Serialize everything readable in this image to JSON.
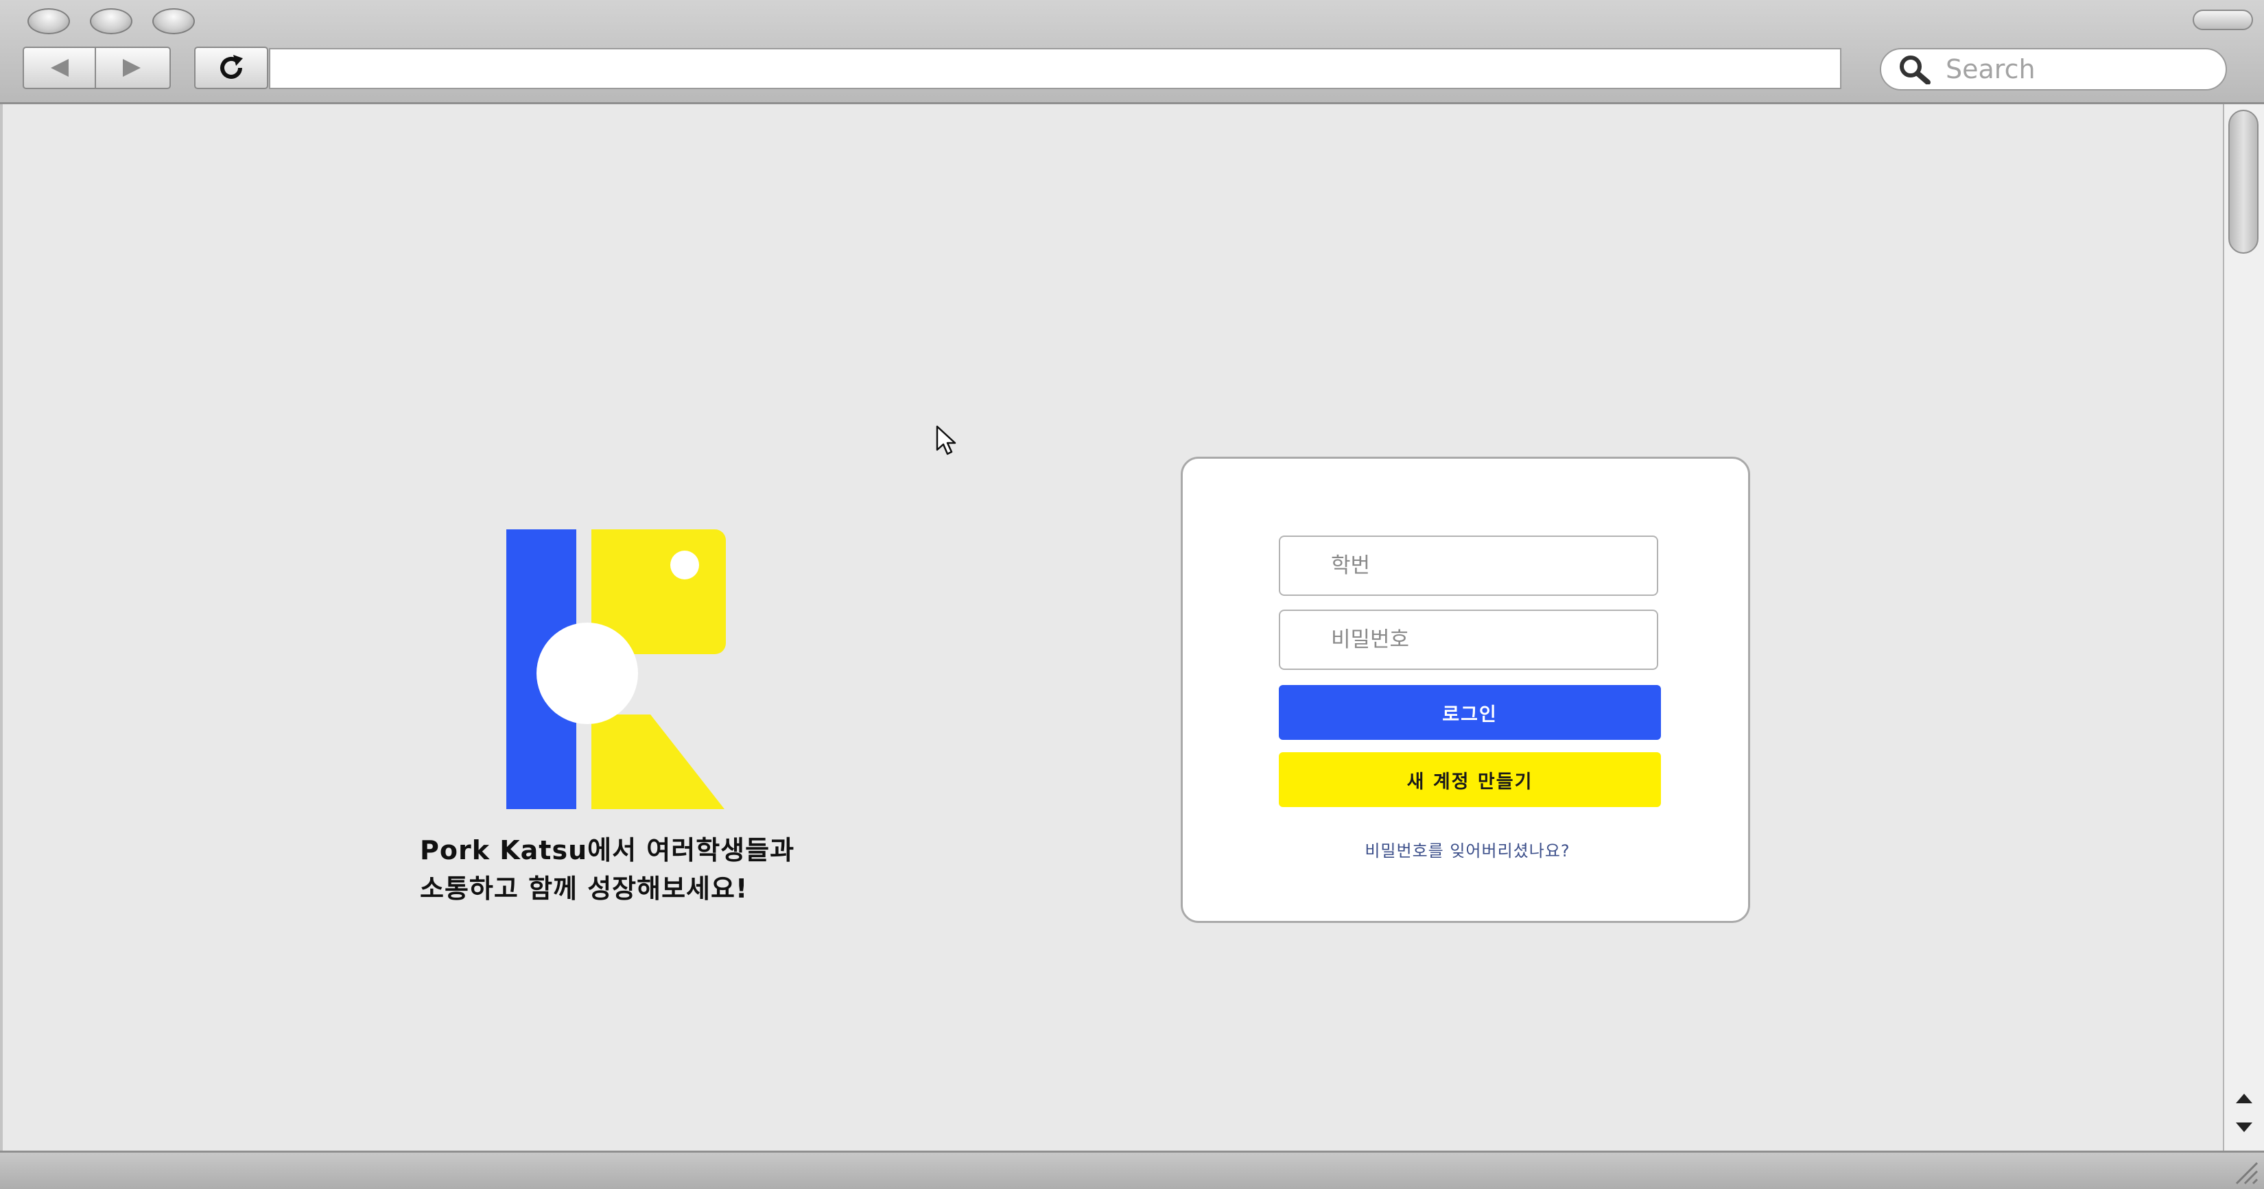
{
  "browser": {
    "url": "",
    "search_placeholder": "Search",
    "icons": {
      "back": "back-arrow-icon",
      "forward": "forward-arrow-icon",
      "reload": "reload-icon",
      "search": "search-icon"
    }
  },
  "brand": {
    "logo_colors": {
      "blue": "#2c58f5",
      "yellow": "#faed16",
      "white": "#ffffff"
    },
    "tagline_line1": "Pork Katsu에서 여러학생들과",
    "tagline_line2": "소통하고 함께 성장해보세요!"
  },
  "login": {
    "student_id_placeholder": "학번",
    "password_placeholder": "비밀번호",
    "login_button": "로그인",
    "signup_button": "새 계정 만들기",
    "forgot_password": "비밀번호를 잊어버리셨나요?",
    "colors": {
      "login": "#2c58f5",
      "signup": "#fff000"
    }
  }
}
